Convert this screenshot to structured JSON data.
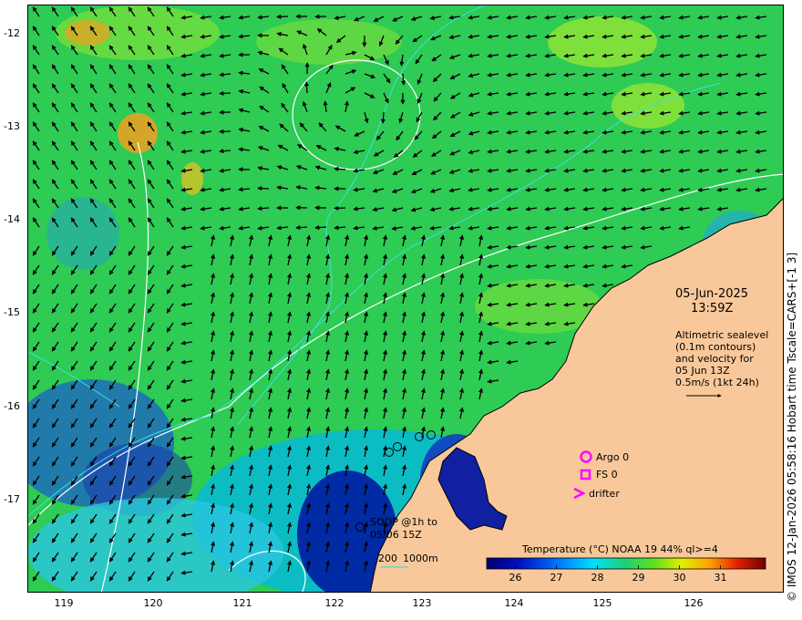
{
  "map": {
    "date": "05-Jun-2025",
    "time": "13:59Z",
    "altimetry_lines": [
      "Altimetric sealevel",
      "(0.1m contours)",
      "and velocity for",
      "05 Jun 13Z",
      "0.5m/s (1kt 24h)"
    ],
    "legend": {
      "argo": "Argo 0",
      "fs": "FS 0",
      "drifter": "drifter",
      "soop_line1": "SOOP @1h to",
      "soop_line2": "05/06 15Z",
      "depth_200": "200",
      "depth_1000": "1000m"
    },
    "colorbar": {
      "title": "Temperature (°C) NOAA 19 44% ql>=4",
      "ticks": [
        "26",
        "27",
        "28",
        "29",
        "30",
        "31"
      ],
      "range": [
        25.3,
        32.1
      ]
    },
    "y_ticks": [
      "-12",
      "-13",
      "-14",
      "-15",
      "-16",
      "-17"
    ],
    "x_ticks": [
      "119",
      "120",
      "121",
      "122",
      "123",
      "124",
      "125",
      "126"
    ],
    "side_caption": "© IMOS 12-Jan-2026 05:58:16 Hobart time Tscale=CARS+[-1 3]",
    "colors": {
      "land": "#f9c89a",
      "coast": "#000000",
      "contour": "#ffffff",
      "isobath": "#3fe0e0",
      "argo": "#ff00ff",
      "drifter": "#ff00ff"
    },
    "extent": {
      "lon": [
        118.6,
        126.95
      ],
      "lat": [
        -17.95,
        -11.65
      ]
    }
  }
}
